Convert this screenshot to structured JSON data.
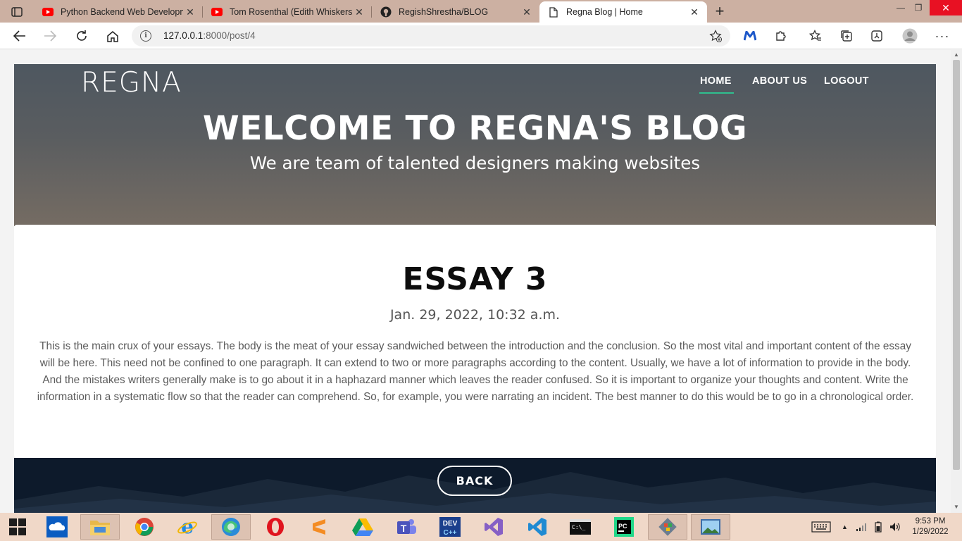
{
  "browser": {
    "tabs": [
      {
        "title": "Python Backend Web Developme",
        "icon": "youtube-icon"
      },
      {
        "title": "Tom Rosenthal (Edith Whiskers) -",
        "icon": "youtube-icon"
      },
      {
        "title": "RegishShrestha/BLOG",
        "icon": "github-icon"
      },
      {
        "title": "Regna Blog | Home",
        "icon": "page-icon"
      }
    ],
    "url_host": "127.0.0.1",
    "url_path": ":8000/post/4"
  },
  "site": {
    "logo": "REGNA",
    "nav": [
      "HOME",
      "ABOUT US",
      "LOGOUT"
    ],
    "hero_title": "WELCOME TO REGNA'S BLOG",
    "hero_subtitle": "We are team of talented designers making websites"
  },
  "post": {
    "title": "ESSAY 3",
    "date": "Jan. 29, 2022, 10:32 a.m.",
    "body": "This is the main crux of your essays. The body is the meat of your essay sandwiched between the introduction and the conclusion. So the most vital and important content of the essay will be here. This need not be confined to one paragraph. It can extend to two or more paragraphs according to the content. Usually, we have a lot of information to provide in the body. And the mistakes writers generally make is to go about it in a haphazard manner which leaves the reader confused. So it is important to organize your thoughts and content. Write the information in a systematic flow so that the reader can comprehend. So, for example, you were narrating an incident. The best manner to do this would be to go in a chronological order.",
    "back_label": "BACK"
  },
  "taskbar": {
    "apps": [
      "start-icon",
      "onedrive-icon",
      "file-explorer-icon",
      "chrome-icon",
      "internet-explorer-icon",
      "edge-icon",
      "opera-icon",
      "sublime-text-icon",
      "google-drive-icon",
      "teams-icon",
      "devcpp-icon",
      "visual-studio-icon",
      "vscode-icon",
      "terminal-icon",
      "pycharm-icon",
      "git-icon",
      "image-viewer-icon"
    ],
    "time": "9:53 PM",
    "date": "1/29/2022"
  },
  "colors": {
    "accent_underline": "#2fbf8f",
    "close_button": "#e81123",
    "footer": "#0d1a2b"
  }
}
